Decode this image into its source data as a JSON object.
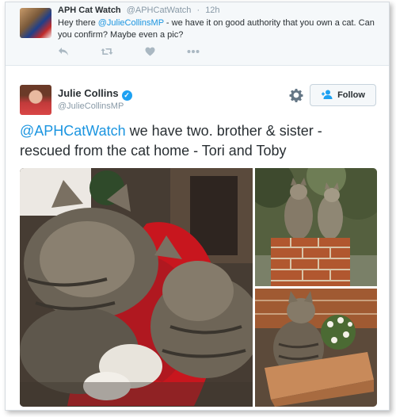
{
  "reply": {
    "name": "APH Cat Watch",
    "handle": "@APHCatWatch",
    "separator": "·",
    "time": "12h",
    "text_before": "Hey there ",
    "mention": "@JulieCollinsMP",
    "text_after": " - we have it on good authority that you own a cat. Can you confirm? Maybe even a pic?",
    "actions": [
      "reply-icon",
      "retweet-icon",
      "like-icon",
      "more-icon"
    ]
  },
  "tweet": {
    "name": "Julie Collins",
    "handle": "@JulieCollinsMP",
    "verified_mark": "✓",
    "follow_label": "Follow",
    "mention": "@APHCatWatch",
    "text": " we have two. brother & sister - rescued from the cat home - Tori and Toby"
  },
  "colors": {
    "link": "#1b95e0",
    "verified": "#1da1f2",
    "muted": "#8899a6",
    "text": "#292f33"
  }
}
